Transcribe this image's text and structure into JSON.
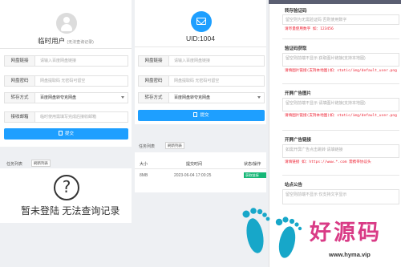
{
  "left_panel": {
    "user_title": "临时用户",
    "user_note": "(无法查询记录)",
    "fields": [
      {
        "label": "网盘链接",
        "placeholder": "请输入百度网盘链接"
      },
      {
        "label": "网盘密码",
        "placeholder": "网盘提取码 无密码可留空"
      },
      {
        "label": "转存方式",
        "value": "百度网盘转夸克网盘"
      },
      {
        "label": "接收邮箱",
        "placeholder": "临时使用需填写完成后接收邮箱"
      }
    ],
    "submit_label": "提交",
    "tasks_label": "任务列表",
    "refresh_label": "刷新列表",
    "empty_icon": "?",
    "empty_message": "暂未登陆 无法查询记录"
  },
  "mid_panel": {
    "uid_label": "UID:1004",
    "fields": [
      {
        "label": "网盘链接",
        "placeholder": "请输入百度网盘链接"
      },
      {
        "label": "网盘密码",
        "placeholder": "网盘提取码 无密码可留空"
      },
      {
        "label": "转存方式",
        "value": "百度网盘转夸克网盘"
      }
    ],
    "submit_label": "提交",
    "tasks_label": "任务列表",
    "refresh_label": "刷新列表",
    "table_headers": [
      "大小",
      "提交时间",
      "状态/操作"
    ],
    "rows": [
      {
        "size": "8MB",
        "time": "2023-06-04 17:00:25",
        "status": "获取链接"
      }
    ]
  },
  "right_panel": {
    "sections": [
      {
        "title": "转存验证码",
        "placeholder": "留空则为无需验证码 否则使用数字",
        "note": "请尽量使用数字 如：123456"
      },
      {
        "title": "验证码获取",
        "placeholder": "留空则前端不显示 获取图片链接(支持本地图)",
        "note": "请填图片链接(支持本地图)如：static/img/default_user.png"
      },
      {
        "title": "开屏广告图片",
        "placeholder": "留空则前端不显示 请填图片链接(支持本地图)",
        "note": "请填图片链接(支持本地图)如：static/img/default_user.png"
      },
      {
        "title": "开屏广告链接",
        "placeholder": "如需开屏广告点击跳转 请填链接",
        "note": "请填链接 如：https://www.*.com 需携带协议头"
      },
      {
        "title": "站点公告",
        "placeholder": "留空则前端不显示 仅支持文字显示",
        "note": ""
      }
    ]
  },
  "watermark": {
    "text": "好源码",
    "url": "www.hyma.vip",
    "colors": {
      "feet": "#17a7c9",
      "text": "#d93b86"
    }
  },
  "colors": {
    "accent": "#1e9fff",
    "success": "#16b777",
    "panel": "#ffffff",
    "bg": "#eef0f3"
  }
}
